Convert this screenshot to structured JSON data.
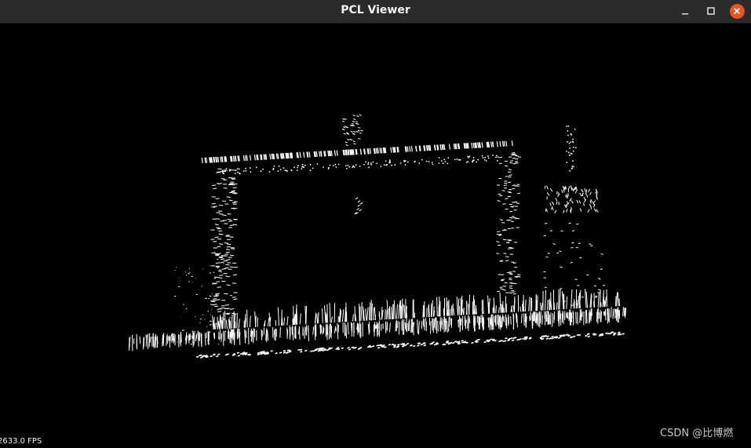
{
  "window": {
    "title": "PCL Viewer"
  },
  "controls": {
    "minimize_icon": "minimize-icon",
    "maximize_icon": "maximize-icon",
    "close_icon": "close-icon",
    "close_color": "#e95420"
  },
  "viewer": {
    "background": "#000000",
    "point_color": "#ffffff",
    "fps_text": "2633.0 FPS"
  },
  "watermark": {
    "text": "CSDN @比博燃"
  }
}
